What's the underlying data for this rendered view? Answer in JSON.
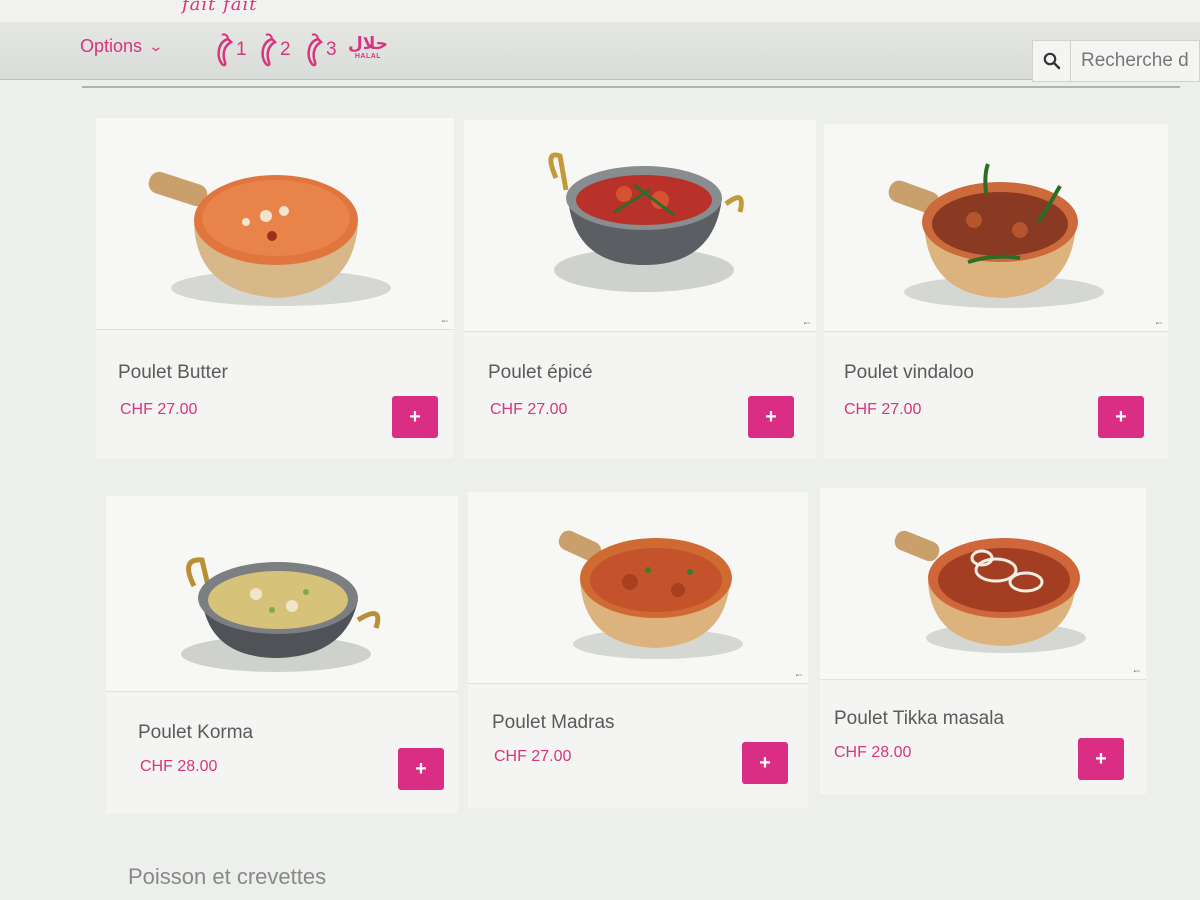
{
  "header": {
    "logo_text": "fait fait",
    "options_label": "Options",
    "spice_levels": [
      "1",
      "2",
      "3"
    ],
    "halal_arabic": "حلال",
    "halal_label": "HALAL",
    "search_placeholder": "Recherche d"
  },
  "products": [
    {
      "name": "Poulet Butter",
      "price": "CHF 27.00",
      "add_label": "+"
    },
    {
      "name": "Poulet épicé",
      "price": "CHF 27.00",
      "add_label": "+"
    },
    {
      "name": "Poulet vindaloo",
      "price": "CHF 27.00",
      "add_label": "+"
    },
    {
      "name": "Poulet Korma",
      "price": "CHF 28.00",
      "add_label": "+"
    },
    {
      "name": "Poulet Madras",
      "price": "CHF 27.00",
      "add_label": "+"
    },
    {
      "name": "Poulet Tikka masala",
      "price": "CHF 28.00",
      "add_label": "+"
    }
  ],
  "next_section": {
    "title": "Poisson et crevettes"
  },
  "colors": {
    "accent": "#d92e83",
    "price": "#d6357f",
    "text": "#5a5a5a"
  }
}
